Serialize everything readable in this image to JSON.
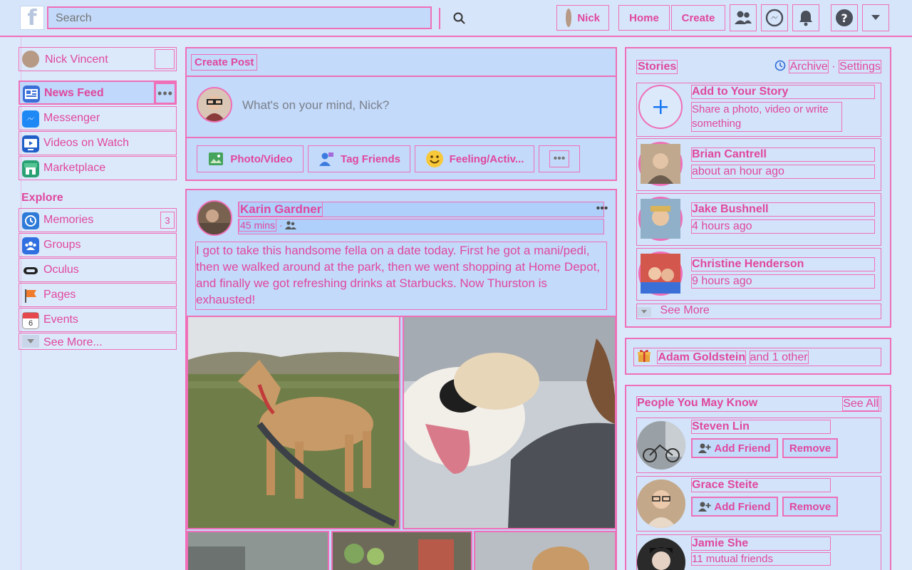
{
  "topbar": {
    "logo": "f",
    "search_placeholder": "Search",
    "user_name": "Nick",
    "home": "Home",
    "create": "Create"
  },
  "left": {
    "profile_name": "Nick Vincent",
    "items": [
      {
        "label": "News Feed",
        "icon": "news-feed-icon"
      },
      {
        "label": "Messenger",
        "icon": "messenger-icon"
      },
      {
        "label": "Videos on Watch",
        "icon": "watch-icon"
      },
      {
        "label": "Marketplace",
        "icon": "marketplace-icon"
      }
    ],
    "explore_title": "Explore",
    "explore": [
      {
        "label": "Memories",
        "badge": "3"
      },
      {
        "label": "Groups"
      },
      {
        "label": "Oculus"
      },
      {
        "label": "Pages"
      },
      {
        "label": "Events",
        "day": "6"
      }
    ],
    "see_more": "See More..."
  },
  "create_post": {
    "title": "Create Post",
    "prompt": "What's on your mind, Nick?",
    "photo_video": "Photo/Video",
    "tag_friends": "Tag Friends",
    "feeling": "Feeling/Activ..."
  },
  "post": {
    "author": "Karin Gardner",
    "time": "45 mins",
    "separator": "·",
    "text": "I got to take this handsome fella on a date today. First he got a mani/pedi, then we walked around at the park, then we went shopping at Home Depot, and finally we got refreshing drinks at Starbucks. Now Thurston is exhausted!"
  },
  "stories": {
    "title": "Stories",
    "archive": "Archive",
    "separator": "·",
    "settings": "Settings",
    "add_title": "Add to Your Story",
    "add_sub": "Share a photo, video or write something",
    "items": [
      {
        "name": "Brian Cantrell",
        "time": "about an hour ago"
      },
      {
        "name": "Jake Bushnell",
        "time": "4 hours ago"
      },
      {
        "name": "Christine Henderson",
        "time": "9 hours ago"
      }
    ],
    "see_more": "See More"
  },
  "birthday": {
    "name": "Adam Goldstein",
    "rest": "and 1 other"
  },
  "pymk": {
    "title": "People You May Know",
    "see_all": "See All",
    "add_friend": "Add Friend",
    "remove": "Remove",
    "people": [
      {
        "name": "Steven Lin"
      },
      {
        "name": "Grace Steite"
      },
      {
        "name": "Jamie She",
        "sub": "11 mutual friends"
      }
    ]
  },
  "colors": {
    "accent": "#e0479e",
    "outline": "#ef6fb8",
    "fb_blue": "#1877f2",
    "background": "#dce9fb"
  }
}
